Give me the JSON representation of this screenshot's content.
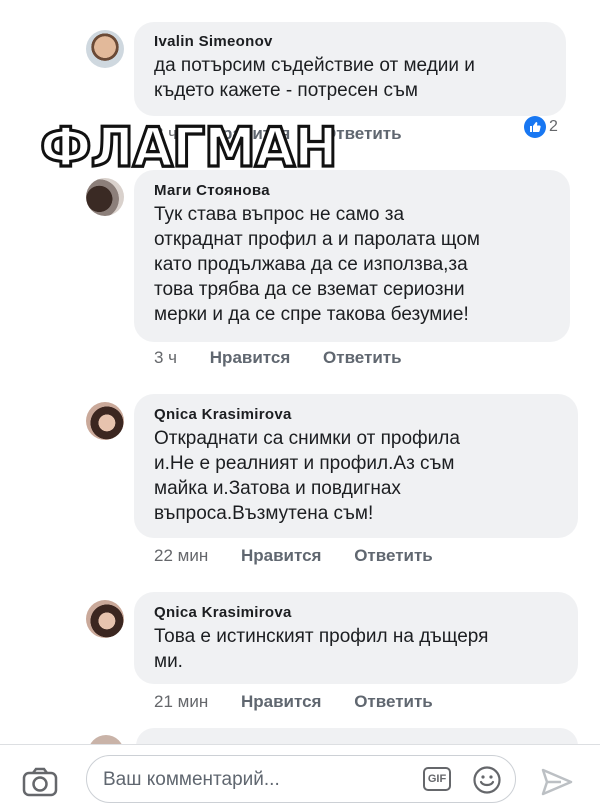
{
  "watermark": "ФЛАГМАН",
  "comments": [
    {
      "author": "Ivalin Simeonov",
      "lines": [
        "да потърсим съдействие от медии и",
        "където кажете - потресен съм"
      ],
      "time": "3 ч",
      "like_label": "Нравится",
      "reply_label": "Ответить",
      "reaction_count": "2"
    },
    {
      "author": "Маги Стоянова",
      "lines": [
        "Тук става въпрос не само за",
        "откраднат профил а и паролата щом",
        "като продължава да се използва,за",
        "това трябва да се вземат сериозни",
        "мерки и да се спре такова безумие!"
      ],
      "time": "3 ч",
      "like_label": "Нравится",
      "reply_label": "Ответить"
    },
    {
      "author": "Qnica Krasimirova",
      "lines": [
        "Откраднати са снимки от профила",
        "и.Не е реалният и профил.Аз съм",
        "майка и.Затова и повдигнах",
        "въпроса.Възмутена съм!"
      ],
      "time": "22 мин",
      "like_label": "Нравится",
      "reply_label": "Ответить"
    },
    {
      "author": "Qnica Krasimirova",
      "lines": [
        "Това е истинският профил на дъщеря",
        "ми."
      ],
      "time": "21 мин",
      "like_label": "Нравится",
      "reply_label": "Ответить"
    }
  ],
  "composer": {
    "placeholder": "Ваш комментарий...",
    "gif_label": "GIF"
  },
  "colors": {
    "bubble": "#f0f1f3",
    "like_blue": "#1877f2",
    "meta_gray": "#65676b"
  }
}
